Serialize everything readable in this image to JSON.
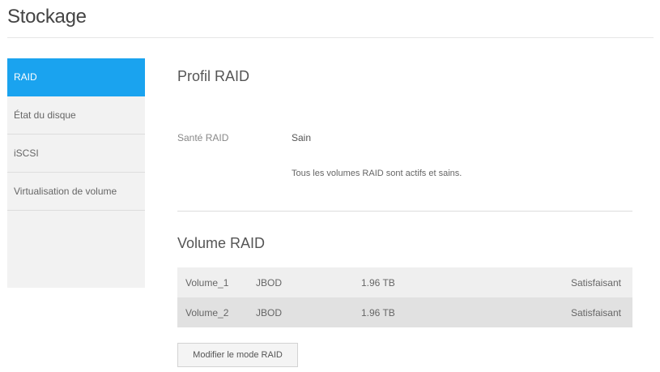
{
  "page": {
    "title": "Stockage"
  },
  "sidebar": {
    "items": [
      {
        "label": "RAID",
        "active": true
      },
      {
        "label": "État du disque",
        "active": false
      },
      {
        "label": "iSCSI",
        "active": false
      },
      {
        "label": "Virtualisation de volume",
        "active": false
      }
    ]
  },
  "profile": {
    "title": "Profil RAID",
    "health_label": "Santé RAID",
    "health_value": "Sain",
    "health_desc": "Tous les volumes RAID sont actifs et sains."
  },
  "volumes": {
    "title": "Volume RAID",
    "rows": [
      {
        "name": "Volume_1",
        "type": "JBOD",
        "size": "1.96 TB",
        "status": "Satisfaisant"
      },
      {
        "name": "Volume_2",
        "type": "JBOD",
        "size": "1.96 TB",
        "status": "Satisfaisant"
      }
    ]
  },
  "actions": {
    "modify_raid_label": "Modifier le mode RAID"
  },
  "colors": {
    "accent": "#1aa3ef",
    "sidebar_bg": "#f2f2f2",
    "row_odd": "#efefef",
    "row_even": "#e1e1e1"
  }
}
